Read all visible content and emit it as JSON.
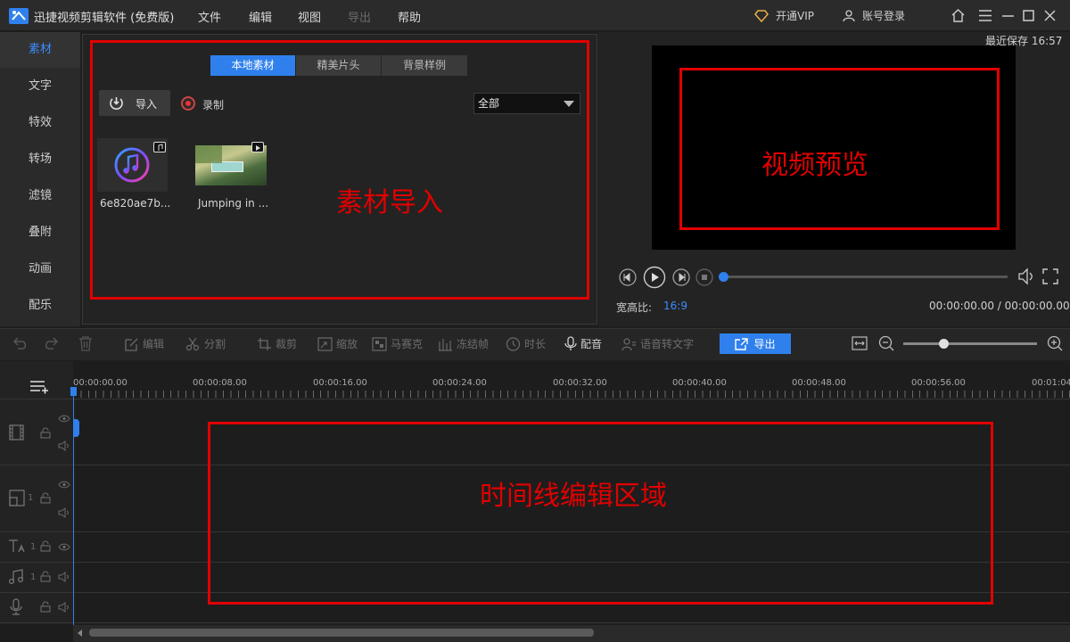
{
  "titlebar": {
    "app_title": "迅捷视频剪辑软件 (免费版)",
    "menus": [
      "文件",
      "编辑",
      "视图",
      "导出",
      "帮助"
    ],
    "vip_label": "开通VIP",
    "login_label": "账号登录"
  },
  "left_tabs": [
    "素材",
    "文字",
    "特效",
    "转场",
    "滤镜",
    "叠附",
    "动画",
    "配乐"
  ],
  "materials": {
    "tabs": [
      "本地素材",
      "精美片头",
      "背景样例"
    ],
    "import_label": "导入",
    "record_label": "录制",
    "filter_value": "全部",
    "items": [
      {
        "label": "6e820ae7b...",
        "icon": "music-note-icon"
      },
      {
        "label": "Jumping in ...",
        "icon": "video-thumbnail"
      }
    ],
    "annotation": "素材导入"
  },
  "preview": {
    "last_saved": "最近保存 16:57",
    "annotation": "视频预览",
    "aspect_label": "宽高比:",
    "aspect_value": "16:9",
    "timecode": "00:00:00.00 / 00:00:00.00",
    "progress": 0
  },
  "toolbar": {
    "tools": [
      "编辑",
      "分割",
      "裁剪",
      "缩放",
      "马赛克",
      "冻结帧",
      "时长",
      "配音",
      "语音转文字"
    ],
    "export_label": "导出",
    "zoom_level": 0.3
  },
  "timeline": {
    "ticks": [
      "00:00:00.00",
      "00:00:08.00",
      "00:00:16.00",
      "00:00:24.00",
      "00:00:32.00",
      "00:00:40.00",
      "00:00:48.00",
      "00:00:56.00",
      "00:01:04"
    ],
    "track_numbers": [
      "1",
      "1",
      "1"
    ],
    "annotation": "时间线编辑区域"
  },
  "colors": {
    "accent": "#2f80ed",
    "annotation_red": "#e10000"
  }
}
